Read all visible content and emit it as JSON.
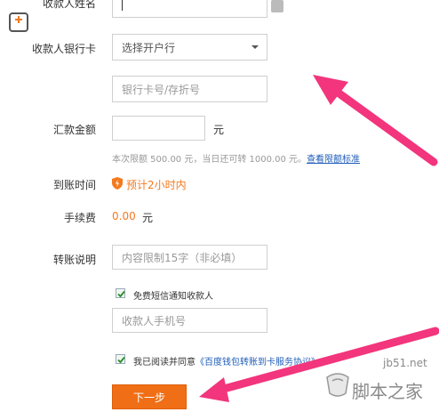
{
  "form": {
    "payee_name_label": "收款人姓名",
    "bank_card_label": "收款人银行卡",
    "bank_select_placeholder": "选择开户行",
    "card_number_placeholder": "银行卡号/存折号",
    "amount_label": "汇款金额",
    "amount_unit": "元",
    "limit_note": "本次限额 500.00 元，当日还可转 1000.00 元。",
    "limit_link": "查看限额标准",
    "arrival_label": "到账时间",
    "arrival_value": "预计2小时内",
    "fee_label": "手续费",
    "fee_value": "0.00",
    "fee_unit": "元",
    "note_label": "转账说明",
    "note_placeholder": "内容限制15字（非必填）",
    "sms_checkbox_label": "免费短信通知收款人",
    "phone_placeholder": "收款人手机号",
    "agree_text": "我已阅读并同意",
    "agree_link": "《百度钱包转账到卡服务协议》",
    "submit_label": "下一步"
  },
  "watermark": {
    "site": "jb51.net",
    "brand": "脚本之家"
  },
  "colors": {
    "accent_orange": "#f06f16",
    "arrow_pink": "#f2357c",
    "link_blue": "#1f5db8"
  }
}
